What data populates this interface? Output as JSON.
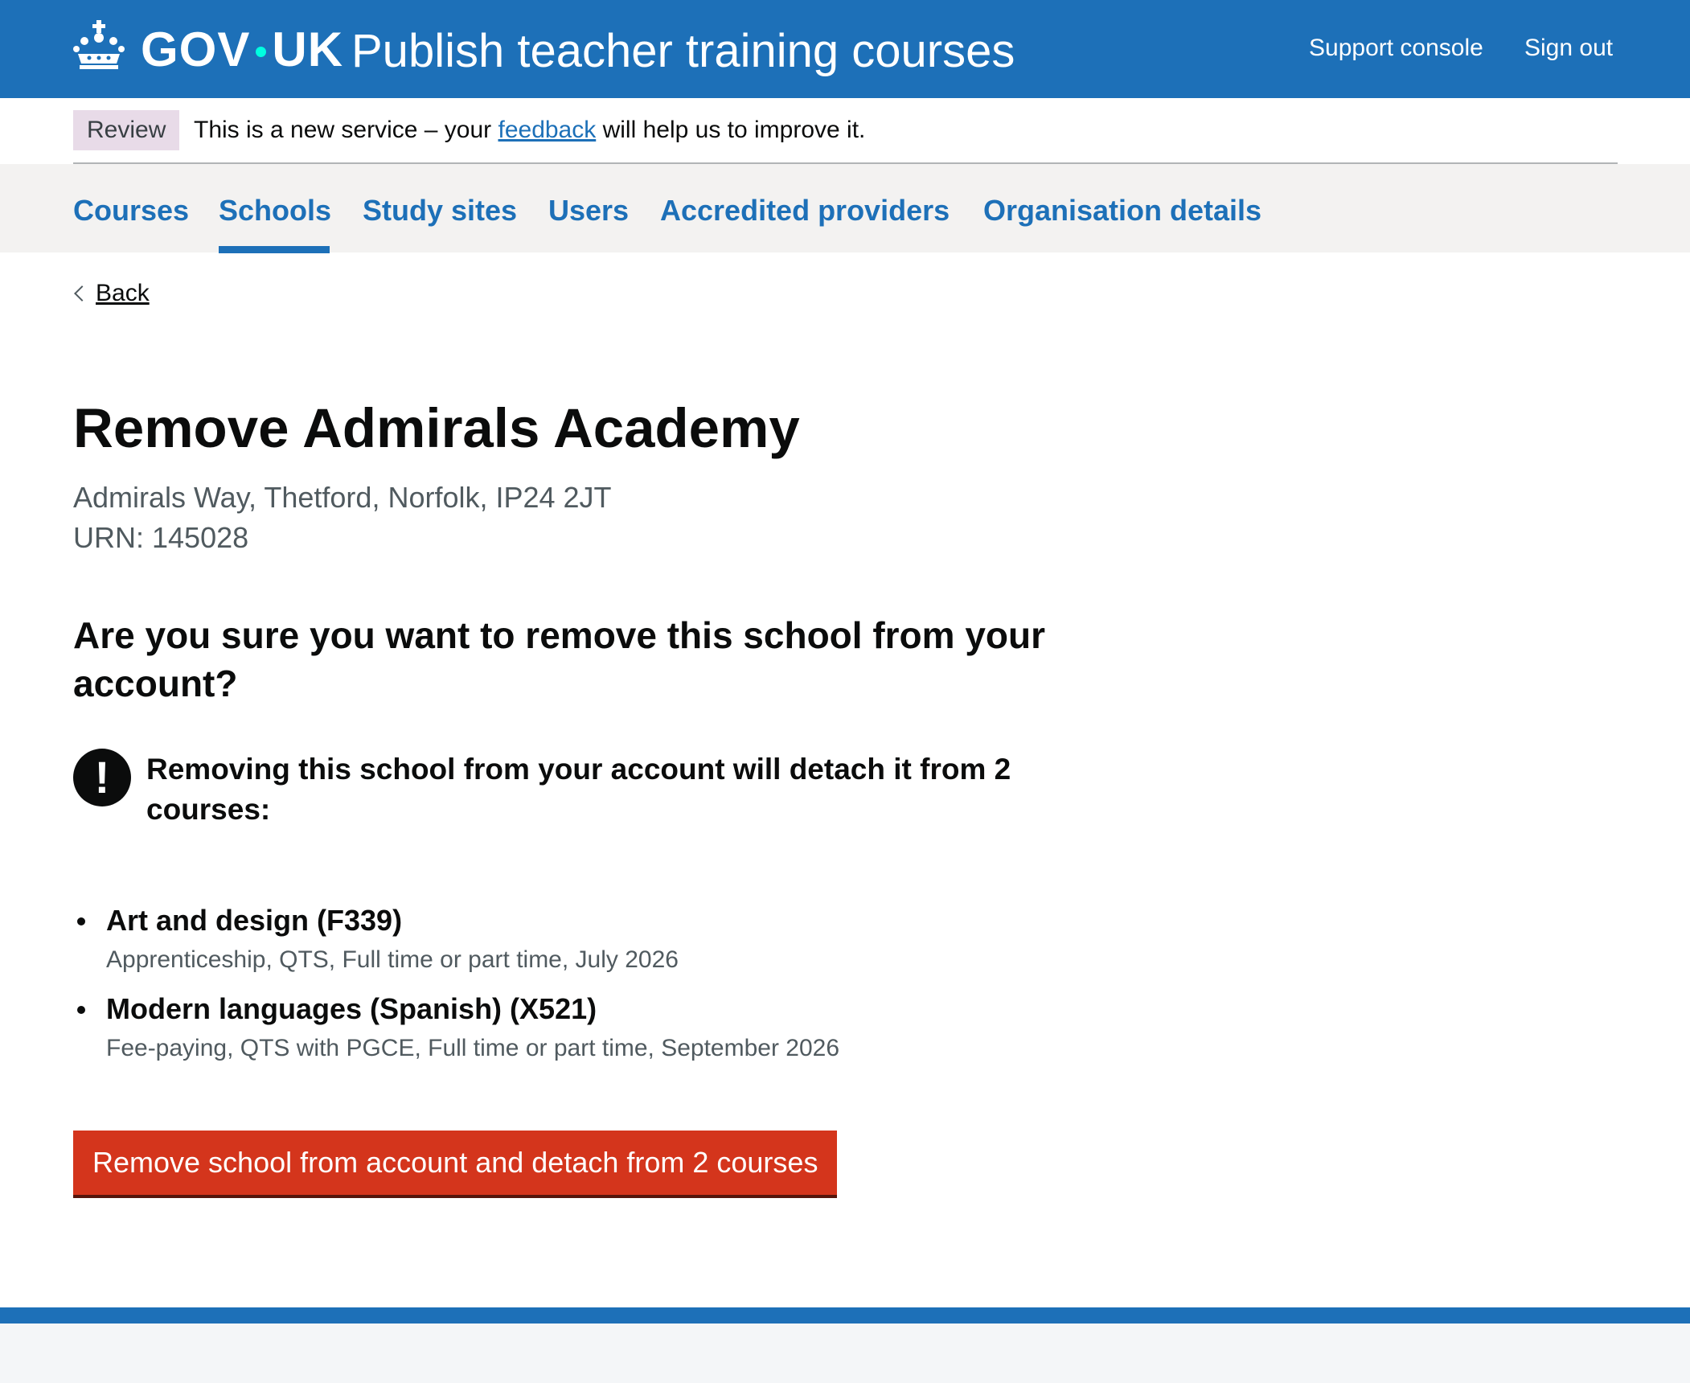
{
  "header": {
    "logo": "GOV",
    "logo_suffix": "UK",
    "service_name": "Publish teacher training courses",
    "links": [
      "Support console",
      "Sign out"
    ],
    "color": "#1d70b8"
  },
  "phase_banner": {
    "tag": "Review",
    "message_before": "This is a new service – your ",
    "link": "feedback",
    "message_after": " will help us to improve it."
  },
  "subnav": {
    "items": [
      "Courses",
      "Schools",
      "Study sites",
      "Users",
      "Accredited providers",
      "Organisation details"
    ],
    "active": "Schools"
  },
  "back_link": "Back",
  "page": {
    "title": "Remove Admirals Academy",
    "address": "Admirals Way, Thetford, Norfolk, IP24 2JT",
    "urn": "URN: 145028",
    "question": "Are you sure you want to remove this school from your account?",
    "warning_icon": "!",
    "warning": "Removing this school from your account will detach it from 2 courses:",
    "courses": [
      {
        "name": "Art and design (F339)",
        "meta": "Apprenticeship, QTS, Full time or part time, July 2026"
      },
      {
        "name": "Modern languages (Spanish) (X521)",
        "meta": "Fee-paying, QTS with PGCE, Full time or part time, September 2026"
      }
    ],
    "button": "Remove school from account and detach from 2 courses",
    "button_color": "#d4351c"
  }
}
